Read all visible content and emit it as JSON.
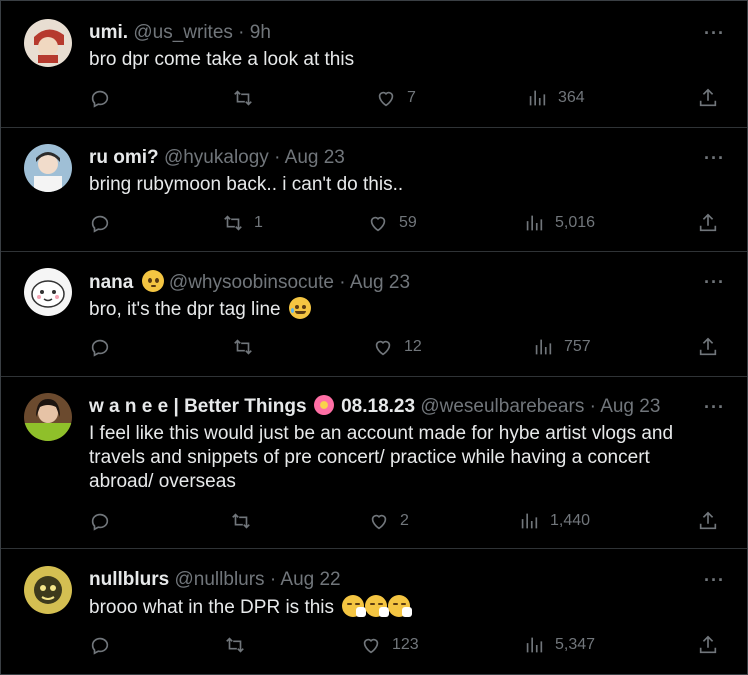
{
  "tweets": [
    {
      "name": "umi.",
      "handle": "@us_writes",
      "sep": "·",
      "time": "9h",
      "text": "bro dpr come take a look at this",
      "reply": "",
      "retweet": "",
      "like": "7",
      "views": "364",
      "avatar_color": "#d8c7b6"
    },
    {
      "name": "ru omi?",
      "handle": "@hyukalogy",
      "sep": "·",
      "time": "Aug 23",
      "text": "bring rubymoon back.. i can't do this..",
      "reply": "",
      "retweet": "1",
      "like": "59",
      "views": "5,016",
      "avatar_color": "#8fb0c8"
    },
    {
      "name": "nana",
      "handle": "@whysoobinsocute",
      "sep": "·",
      "time": "Aug 23",
      "text": "bro, it's the dpr tag line",
      "reply": "",
      "retweet": "",
      "like": "12",
      "views": "757",
      "avatar_color": "#eaeaea"
    },
    {
      "name_prefix": "w a n e e | Better Things",
      "name_suffix": "08.18.23",
      "handle": "@weseulbarebears",
      "sep": "·",
      "time": "Aug 23",
      "text": "I feel like this would just be an account made for hybe artist vlogs and travels and snippets of pre concert/ practice while having a concert abroad/ overseas",
      "reply": "",
      "retweet": "",
      "like": "2",
      "views": "1,440",
      "avatar_color": "#5a4230"
    },
    {
      "name": "nullblurs",
      "handle": "@nullblurs",
      "sep": "·",
      "time": "Aug 22",
      "text": "brooo what in the DPR is this",
      "reply": "",
      "retweet": "",
      "like": "123",
      "views": "5,347",
      "avatar_color": "#c9b24a"
    }
  ],
  "icons": {
    "reply": "reply-icon",
    "retweet": "retweet-icon",
    "like": "heart-icon",
    "views": "views-icon",
    "share": "share-icon",
    "more": "more-icon"
  },
  "more_label": "···"
}
